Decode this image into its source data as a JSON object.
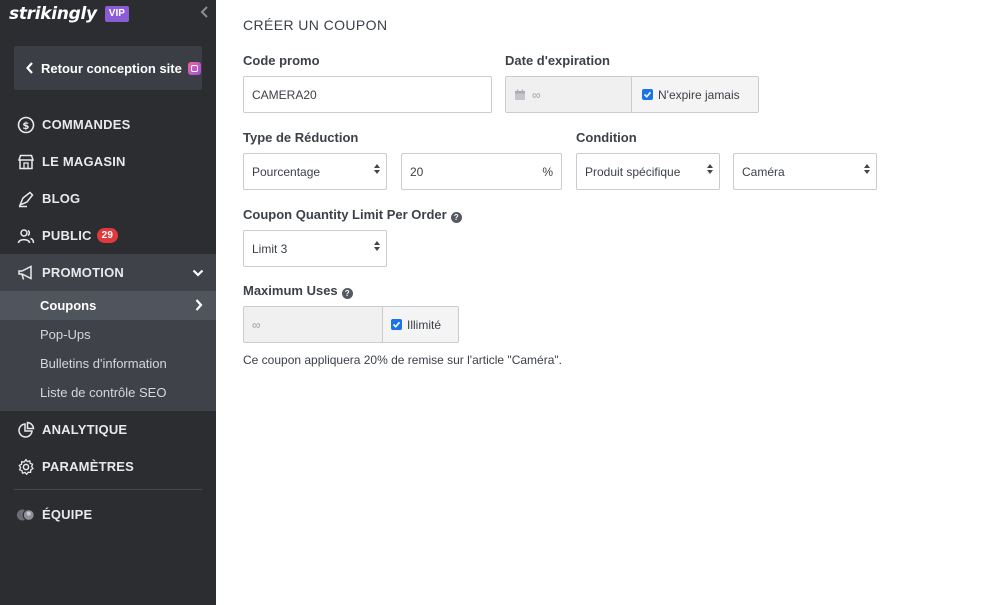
{
  "brand": {
    "logo": "strikingly",
    "vip": "VIP"
  },
  "sidebar": {
    "back_label": "Retour conception site",
    "items": [
      {
        "label": "COMMANDES",
        "icon": "dollar-circle-icon"
      },
      {
        "label": "LE MAGASIN",
        "icon": "store-icon"
      },
      {
        "label": "BLOG",
        "icon": "pen-nib-icon"
      },
      {
        "label": "PUBLIC",
        "icon": "users-icon",
        "badge": "29"
      },
      {
        "label": "PROMOTION",
        "icon": "megaphone-icon",
        "active": true
      }
    ],
    "promotion_sub": [
      {
        "label": "Coupons",
        "selected": true
      },
      {
        "label": "Pop-Ups"
      },
      {
        "label": "Bulletins d'information"
      },
      {
        "label": "Liste de contrôle SEO"
      }
    ],
    "bottom_items": [
      {
        "label": "ANALYTIQUE",
        "icon": "pie-chart-icon"
      },
      {
        "label": "PARAMÈTRES",
        "icon": "gear-icon"
      }
    ],
    "team": {
      "label": "ÉQUIPE",
      "icon": "team-avatars-icon"
    }
  },
  "form": {
    "title": "CRÉER UN COUPON",
    "code_label": "Code promo",
    "code_value": "CAMERA20",
    "expiry_label": "Date d'expiration",
    "expiry_value": "∞",
    "expiry_never_label": "N'expire jamais",
    "expiry_never_checked": true,
    "discount_label": "Type de Réduction",
    "discount_type": "Pourcentage",
    "discount_value": "20",
    "discount_suffix": "%",
    "condition_label": "Condition",
    "condition_type": "Produit spécifique",
    "condition_product": "Caméra",
    "qty_limit_label": "Coupon Quantity Limit Per Order",
    "qty_limit_value": "Limit 3",
    "max_uses_label": "Maximum Uses",
    "max_uses_value": "∞",
    "unlimited_label": "Illimité",
    "unlimited_checked": true,
    "summary": "Ce coupon appliquera 20% de remise sur l'article \"Caméra\"."
  },
  "colors": {
    "sidebar_bg": "#2b2d31",
    "sidebar_active": "#3f4249",
    "accent_checkbox": "#1a73e8",
    "badge": "#e0393e",
    "vip": "#8b5cd6"
  }
}
